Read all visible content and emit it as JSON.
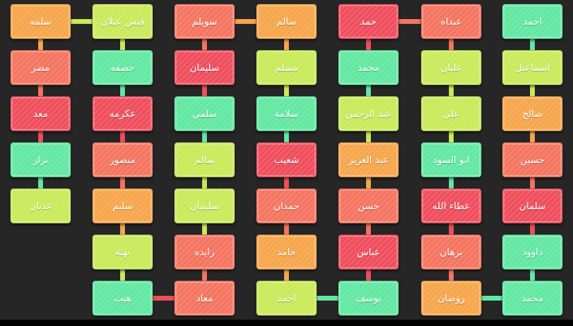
{
  "colors": {
    "green": "#62e8a2",
    "orange": "#f6a64c",
    "red": "#ef4e5c",
    "coral": "#f47560",
    "lime": "#c9ea5a",
    "background": "#262626"
  },
  "columns": [
    {
      "id": "c1",
      "nodes": [
        {
          "name": "احمد",
          "color": "green"
        },
        {
          "name": "اسماعيل",
          "color": "lime"
        },
        {
          "name": "صالح",
          "color": "orange"
        },
        {
          "name": "حسين",
          "color": "coral"
        },
        {
          "name": "سلمان",
          "color": "red"
        },
        {
          "name": "داوود",
          "color": "green"
        },
        {
          "name": "محمد",
          "color": "green"
        }
      ]
    },
    {
      "id": "c2",
      "nodes": [
        {
          "name": "عبداه",
          "color": "coral"
        },
        {
          "name": "عليان",
          "color": "lime"
        },
        {
          "name": "علي",
          "color": "lime"
        },
        {
          "name": "ابو السود",
          "color": "green"
        },
        {
          "name": "عطاء الله",
          "color": "red"
        },
        {
          "name": "برهان",
          "color": "coral"
        },
        {
          "name": "روضان",
          "color": "orange"
        }
      ]
    },
    {
      "id": "c3",
      "nodes": [
        {
          "name": "حمد",
          "color": "red"
        },
        {
          "name": "محمد",
          "color": "green"
        },
        {
          "name": "عبد الرحمن",
          "color": "lime"
        },
        {
          "name": "عبد العزيز",
          "color": "orange"
        },
        {
          "name": "حسن",
          "color": "coral"
        },
        {
          "name": "عباس",
          "color": "red"
        },
        {
          "name": "يوسف",
          "color": "green"
        }
      ]
    },
    {
      "id": "c4",
      "nodes": [
        {
          "name": "سالم",
          "color": "orange"
        },
        {
          "name": "مسلم",
          "color": "lime"
        },
        {
          "name": "سلامة",
          "color": "green"
        },
        {
          "name": "شعيب",
          "color": "red"
        },
        {
          "name": "حمدان",
          "color": "coral"
        },
        {
          "name": "حامد",
          "color": "orange"
        },
        {
          "name": "احمد",
          "color": "lime"
        }
      ]
    },
    {
      "id": "c5",
      "nodes": [
        {
          "name": "سويلم",
          "color": "coral"
        },
        {
          "name": "سليمان",
          "color": "red"
        },
        {
          "name": "سلمي",
          "color": "green"
        },
        {
          "name": "سالم",
          "color": "lime"
        },
        {
          "name": "سليمان",
          "color": "lime"
        },
        {
          "name": "زايده",
          "color": "coral"
        },
        {
          "name": "معاد",
          "color": "coral"
        }
      ]
    },
    {
      "id": "c6",
      "nodes": [
        {
          "name": "قيس عيلان",
          "color": "lime"
        },
        {
          "name": "حصفه",
          "color": "green"
        },
        {
          "name": "عكرمه",
          "color": "red"
        },
        {
          "name": "منصور",
          "color": "coral"
        },
        {
          "name": "سليم",
          "color": "orange"
        },
        {
          "name": "بهثه",
          "color": "lime"
        },
        {
          "name": "هيب",
          "color": "green"
        }
      ]
    },
    {
      "id": "c7",
      "nodes": [
        {
          "name": "سلمه",
          "color": "orange"
        },
        {
          "name": "مضر",
          "color": "coral"
        },
        {
          "name": "معد",
          "color": "red"
        },
        {
          "name": "نزار",
          "color": "green"
        },
        {
          "name": "عدنان",
          "color": "lime"
        }
      ]
    }
  ],
  "links": [
    {
      "from": "c1.6",
      "to": "c2.6",
      "color": "green"
    },
    {
      "from": "c2.0",
      "to": "c3.0",
      "color": "coral"
    },
    {
      "from": "c3.6",
      "to": "c4.6",
      "color": "green"
    },
    {
      "from": "c4.0",
      "to": "c5.0",
      "color": "orange"
    },
    {
      "from": "c5.6",
      "to": "c6.6",
      "color": "red"
    },
    {
      "from": "c6.0",
      "to": "c7.0",
      "color": "lime"
    }
  ]
}
